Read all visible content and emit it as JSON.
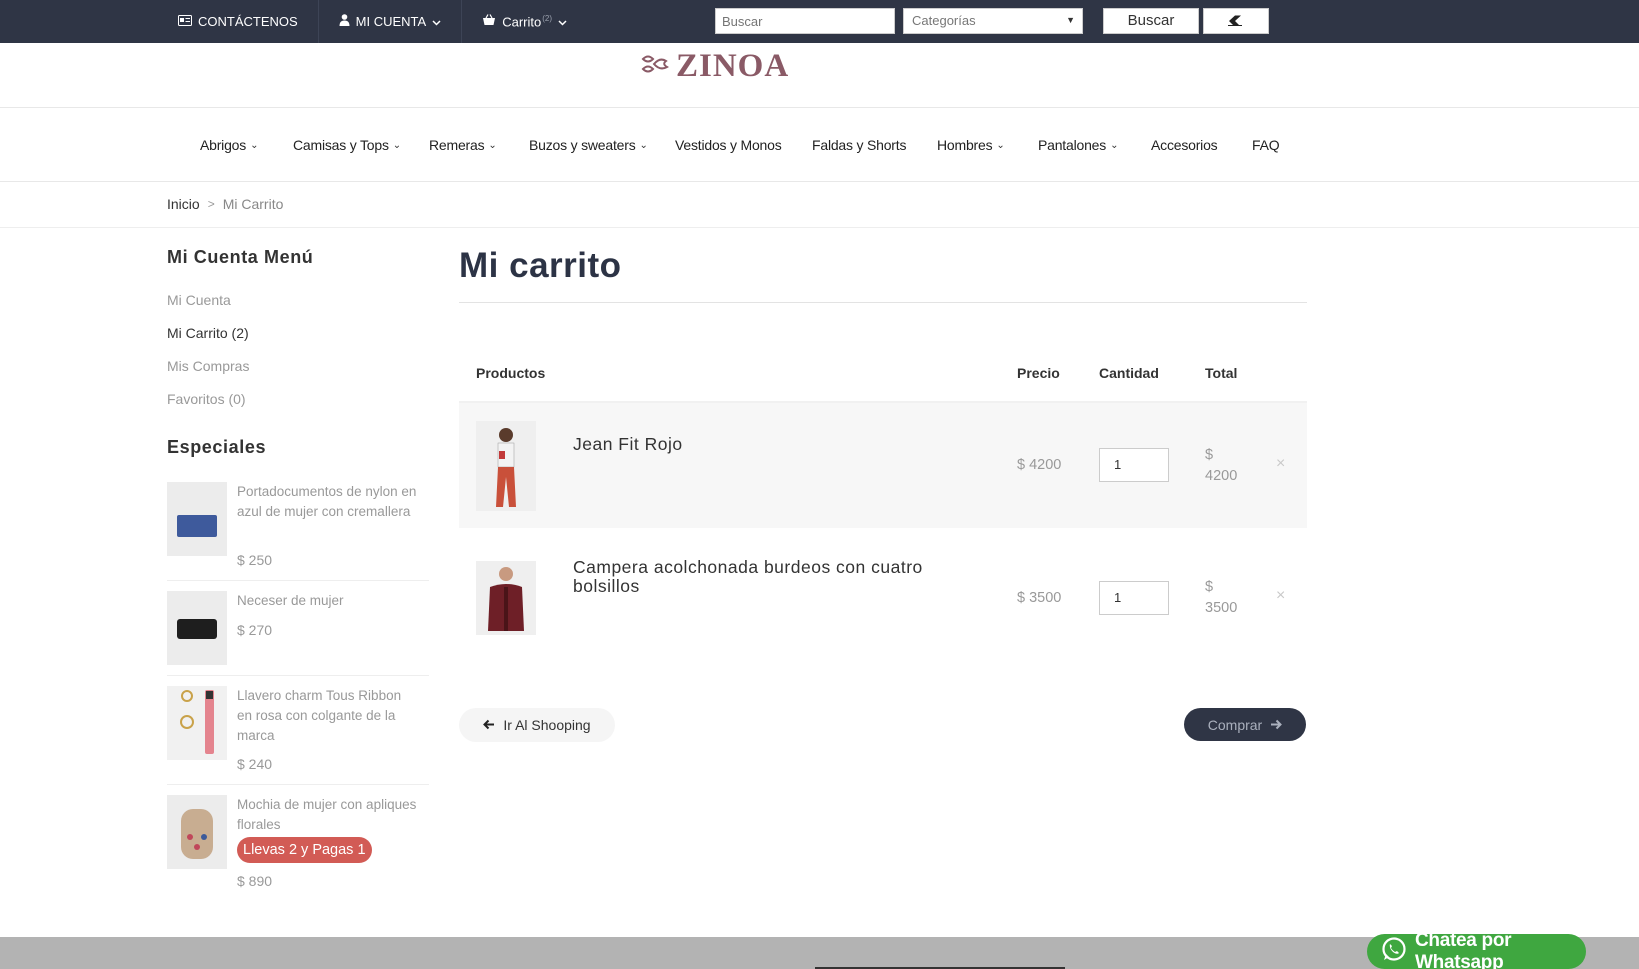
{
  "topbar": {
    "contact_label": "CONTÁCTENOS",
    "account_label": "MI CUENTA",
    "cart_label": "Carrito",
    "cart_count": "(2)",
    "search_placeholder": "Buscar",
    "category_selected": "Categorías",
    "search_button": "Buscar",
    "colors": {
      "bar": "#2f3545"
    }
  },
  "brand": {
    "name": "ZINOA",
    "color": "#8a5a66"
  },
  "nav": {
    "items": [
      {
        "label": "Abrigos",
        "dropdown": true
      },
      {
        "label": "Camisas y Tops",
        "dropdown": true
      },
      {
        "label": "Remeras",
        "dropdown": true
      },
      {
        "label": "Buzos y sweaters",
        "dropdown": true
      },
      {
        "label": "Vestidos y Monos",
        "dropdown": false
      },
      {
        "label": "Faldas y Shorts",
        "dropdown": false
      },
      {
        "label": "Hombres",
        "dropdown": true
      },
      {
        "label": "Pantalones",
        "dropdown": true
      },
      {
        "label": "Accesorios",
        "dropdown": false
      },
      {
        "label": "FAQ",
        "dropdown": false
      }
    ]
  },
  "breadcrumb": {
    "home": "Inicio",
    "separator": ">",
    "current": "Mi Carrito"
  },
  "sidebar": {
    "menu_title": "Mi Cuenta Menú",
    "links": [
      {
        "label": "Mi Cuenta"
      },
      {
        "label": "Mi Carrito (2)"
      },
      {
        "label": "Mis Compras"
      },
      {
        "label": "Favoritos (0)"
      }
    ],
    "specials_title": "Especiales",
    "specials": [
      {
        "name": "Portadocumentos de nylon en azul de mujer con cremallera",
        "price": "$ 250"
      },
      {
        "name": "Neceser de mujer",
        "price": "$ 270"
      },
      {
        "name": "Llavero charm Tous Ribbon en rosa con colgante de la marca",
        "price": "$ 240"
      },
      {
        "name": "Mochia de mujer con apliques florales",
        "promo": "Llevas 2 y Pagas 1",
        "price": "$ 890"
      }
    ]
  },
  "cart": {
    "title": "Mi carrito",
    "headers": {
      "product": "Productos",
      "price": "Precio",
      "quantity": "Cantidad",
      "total": "Total"
    },
    "items": [
      {
        "name": "Jean Fit Rojo",
        "price": "$ 4200",
        "quantity": "1",
        "total_currency": "$",
        "total_amount": "4200"
      },
      {
        "name": "Campera acolchonada burdeos con cuatro bolsillos",
        "price": "$ 3500",
        "quantity": "1",
        "total_currency": "$",
        "total_amount": "3500"
      }
    ],
    "remove_symbol": "×",
    "continue_label": "Ir Al Shooping",
    "buy_label": "Comprar"
  },
  "whatsapp": {
    "label": "Chatea por Whatsapp",
    "color": "#3fa740"
  }
}
